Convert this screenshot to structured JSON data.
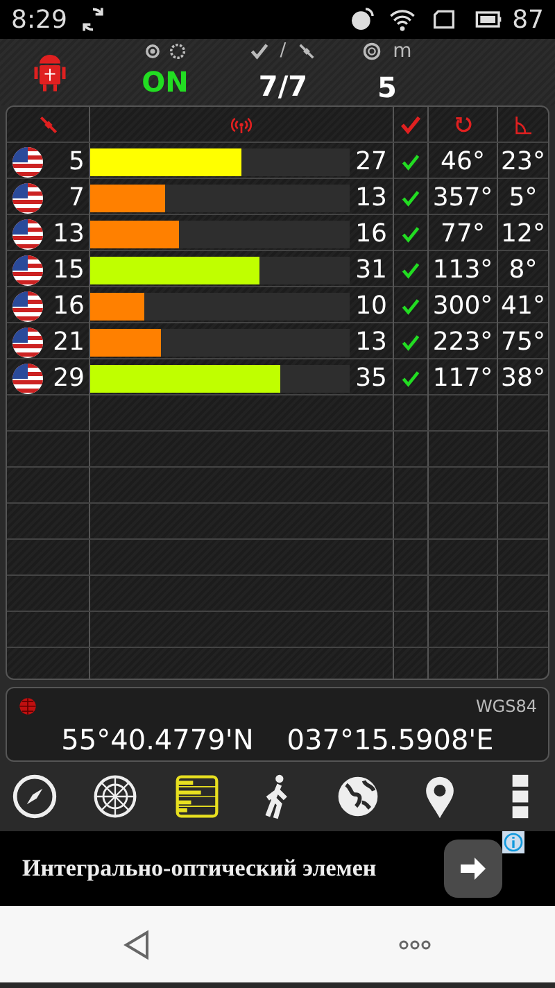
{
  "status_bar": {
    "time": "8:29",
    "battery": "87"
  },
  "header": {
    "fix": "ON",
    "fix_on": true,
    "slash": "/",
    "satellites": "7/7",
    "accuracy_unit": "m",
    "accuracy": "5"
  },
  "satellites": [
    {
      "prn": "5",
      "level": 0.58,
      "color": "#ffff00",
      "snr": "27",
      "used": true,
      "azimuth": "46°",
      "elevation": "23°"
    },
    {
      "prn": "7",
      "level": 0.29,
      "color": "#ff8000",
      "snr": "13",
      "used": true,
      "azimuth": "357°",
      "elevation": "5°"
    },
    {
      "prn": "13",
      "level": 0.34,
      "color": "#ff8000",
      "snr": "16",
      "used": true,
      "azimuth": "77°",
      "elevation": "12°"
    },
    {
      "prn": "15",
      "level": 0.65,
      "color": "#c0ff00",
      "snr": "31",
      "used": true,
      "azimuth": "113°",
      "elevation": "8°"
    },
    {
      "prn": "16",
      "level": 0.21,
      "color": "#ff8000",
      "snr": "10",
      "used": true,
      "azimuth": "300°",
      "elevation": "41°"
    },
    {
      "prn": "21",
      "level": 0.27,
      "color": "#ff8000",
      "snr": "13",
      "used": true,
      "azimuth": "223°",
      "elevation": "75°"
    },
    {
      "prn": "29",
      "level": 0.73,
      "color": "#c0ff00",
      "snr": "35",
      "used": true,
      "azimuth": "117°",
      "elevation": "38°"
    }
  ],
  "position": {
    "datum": "WGS84",
    "latitude": "55°40.4779'N",
    "longitude": "037°15.5908'E"
  },
  "toolbar": [
    {
      "kind": "compass",
      "selected": false
    },
    {
      "kind": "radar",
      "selected": false
    },
    {
      "kind": "signal",
      "selected": true
    },
    {
      "kind": "walk",
      "selected": false
    },
    {
      "kind": "globe",
      "selected": false
    },
    {
      "kind": "pin",
      "selected": false
    },
    {
      "kind": "more",
      "selected": false
    }
  ],
  "ad": {
    "text": "Интегрально-оптический элемен"
  }
}
